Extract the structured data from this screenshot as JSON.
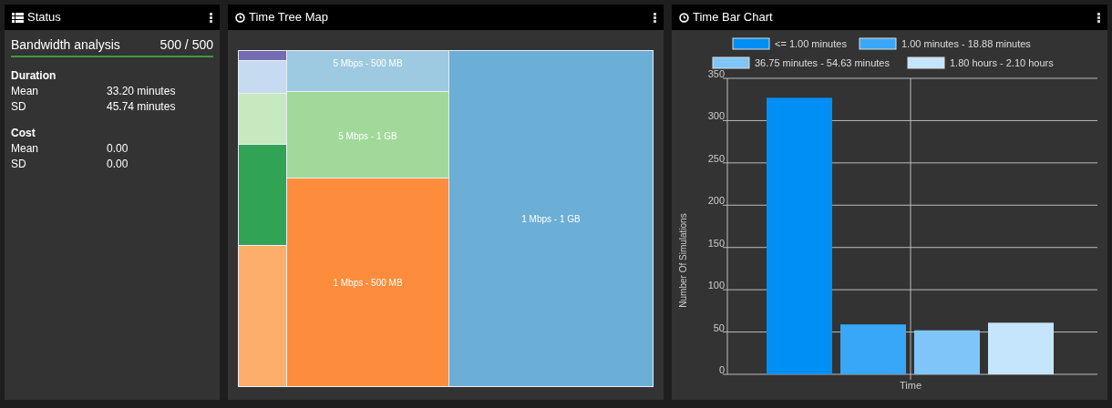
{
  "status_panel": {
    "title": "Status",
    "analysis": {
      "name": "Bandwidth analysis",
      "progress": "500 / 500"
    },
    "sections": [
      {
        "heading": "Duration",
        "rows": [
          {
            "label": "Mean",
            "value": "33.20 minutes"
          },
          {
            "label": "SD",
            "value": "45.74 minutes"
          }
        ]
      },
      {
        "heading": "Cost",
        "rows": [
          {
            "label": "Mean",
            "value": "0.00"
          },
          {
            "label": "SD",
            "value": "0.00"
          }
        ]
      }
    ]
  },
  "tree_map_panel": {
    "title": "Time Tree Map",
    "columns": [
      {
        "tiles": [
          {
            "color": "#756bb1"
          },
          {
            "color": "#c6dbef"
          },
          {
            "color": "#c7e9c0"
          },
          {
            "color": "#31a354"
          },
          {
            "color": "#fdae6b"
          }
        ]
      },
      {
        "tiles": [
          {
            "label": "5 Mbps - 500 MB",
            "color": "#9ecae1"
          },
          {
            "label": "5 Mbps - 1 GB",
            "color": "#a1d99b"
          },
          {
            "label": "1 Mbps - 500 MB",
            "color": "#fd8d3c"
          }
        ]
      },
      {
        "tiles": [
          {
            "label": "1 Mbps - 1 GB",
            "color": "#6baed6"
          }
        ]
      }
    ]
  },
  "bar_chart_panel": {
    "title": "Time Bar Chart",
    "chart_data": {
      "type": "bar",
      "xlabel": "Time",
      "ylabel": "Number Of Simulations",
      "ylim": [
        0,
        350
      ],
      "grid": true,
      "legend": true,
      "yticks": [
        0,
        50,
        100,
        150,
        200,
        250,
        300,
        350
      ],
      "series": [
        {
          "name": "<= 1.00 minutes",
          "color": "#008ff5",
          "values": [
            327
          ]
        },
        {
          "name": "1.00 minutes - 18.88 minutes",
          "color": "#39a7f7",
          "values": [
            59
          ]
        },
        {
          "name": "36.75 minutes - 54.63 minutes",
          "color": "#7fc5fa",
          "values": [
            52
          ]
        },
        {
          "name": "1.80 hours - 2.10 hours",
          "color": "#c5e5fd",
          "values": [
            61
          ]
        }
      ]
    }
  }
}
